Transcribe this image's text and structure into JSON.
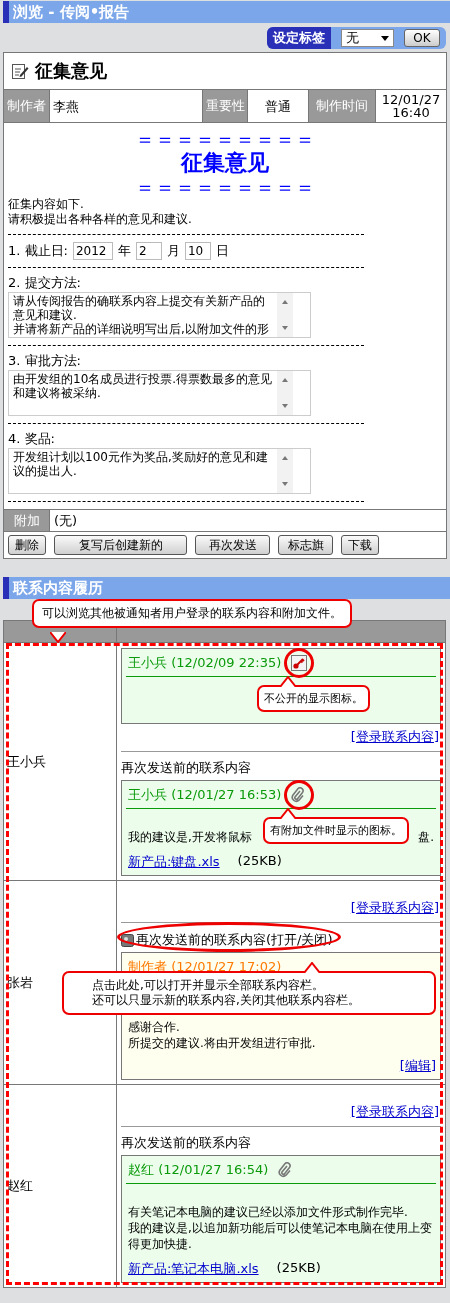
{
  "window": {
    "title": "浏览 - 传阅•报告"
  },
  "tag_bar": {
    "label": "设定标签",
    "value": "无",
    "ok": "OK"
  },
  "document": {
    "title": "征集意见",
    "meta": [
      {
        "label": "制作者",
        "value": "李燕"
      },
      {
        "label": "重要性",
        "value": "普通"
      },
      {
        "label": "制作时间",
        "value": "12/01/27 16:40"
      }
    ],
    "banner": {
      "rule_top": "＝＝＝＝＝＝＝＝＝",
      "title": "征集意见",
      "rule_bottom": "＝＝＝＝＝＝＝＝＝"
    },
    "intro": [
      "征集内容如下.",
      "请积极提出各种各样的意见和建议."
    ],
    "deadline": {
      "label": "1. 截止日:",
      "fields": [
        {
          "value": "2012",
          "unit": "年"
        },
        {
          "value": "2",
          "unit": "月"
        },
        {
          "value": "10",
          "unit": "日"
        }
      ]
    },
    "sections": [
      {
        "label": "2. 提交方法:",
        "text": "请从传阅报告的确联系内容上提交有关新产品的意见和建议.\n并请将新产品的详细说明写出后,以附加文件的形"
      },
      {
        "label": "3. 审批方法:",
        "text": "由开发组的10名成员进行投票.得票数最多的意见和建议将被采纳."
      },
      {
        "label": "4. 奖品:",
        "text": "开发组计划以100元作为奖品,奖励好的意见和建议的提出人."
      }
    ],
    "attachment": {
      "label": "附加",
      "value": "(无)"
    },
    "buttons": [
      "删除",
      "复写后创建新的",
      "再次发送",
      "标志旗",
      "下载"
    ]
  },
  "history": {
    "title": "联系内容履历",
    "note": "可以浏览其他被通知者用户登录的联系内容和附加文件。",
    "rows": [
      {
        "name": "王小兵",
        "items": [
          {
            "kind": "message",
            "color": "#ecfdec",
            "author": "王小兵 (12/02/09 22:35)",
            "private": true,
            "callout": "不公开的显示图标。"
          },
          {
            "kind": "link",
            "text": "[登录联系内容]"
          },
          {
            "kind": "label",
            "text": "再次发送前的联系内容"
          },
          {
            "kind": "message",
            "color": "#ecfdec",
            "author": "王小兵 (12/01/27 16:53)",
            "attached": true,
            "callout": "有附加文件时显示的图标。",
            "body": [
              [
                "我的建议是,开发将鼠标",
                "盘."
              ]
            ],
            "file": {
              "name": "新产品:键盘.xls",
              "size": "(25KB)"
            }
          }
        ]
      },
      {
        "name": "张岩",
        "items": [
          {
            "kind": "link",
            "text": "[登录联系内容]"
          },
          {
            "kind": "toggle",
            "text": "再次发送前的联系内容(打开/关闭)",
            "callout": [
              "点击此处,可以打开并显示全部联系内容栏。",
              "还可以只显示新的联系内容,关闭其他联系内容栏。"
            ]
          },
          {
            "kind": "message",
            "color": "#fffff0",
            "author": "制作者 (12/01/27 17:02)",
            "body": [
              [
                "感谢合作."
              ],
              [
                "所提交的建议.将由开发组进行审批."
              ]
            ],
            "edit": "[编辑]"
          }
        ]
      },
      {
        "name": "赵红",
        "items": [
          {
            "kind": "link",
            "text": "[登录联系内容]"
          },
          {
            "kind": "label",
            "text": "再次发送前的联系内容"
          },
          {
            "kind": "message",
            "color": "#ecfdec",
            "author": "赵红 (12/01/27 16:54)",
            "attached": true,
            "body": [
              [
                "有关笔记本电脑的建议已经以添加文件形式制作完毕."
              ],
              [
                "我的建议是,以追加新功能后可以使笔记本电脑在使用上变得更加快捷."
              ]
            ],
            "file": {
              "name": "新产品:笔记本电脑.xls",
              "size": "(25KB)"
            }
          }
        ]
      }
    ]
  }
}
